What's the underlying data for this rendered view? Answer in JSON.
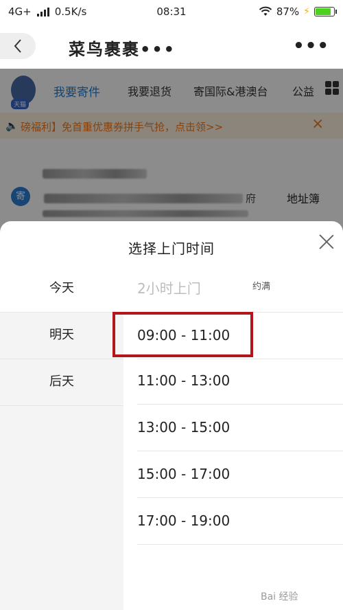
{
  "status_bar": {
    "network": "4G+",
    "speed": "0.5K/s",
    "time": "08:31",
    "battery_percent": "87%",
    "battery_level": 0.87
  },
  "header": {
    "title": "菜鸟裹裹•••"
  },
  "background_page": {
    "nav_items": [
      "我要寄件",
      "我要退货",
      "寄国际&港澳台",
      "公益"
    ],
    "notice": "磅福利】免首重优惠券拼手气抢，点击领>>",
    "send_badge": "寄",
    "fu_text": "府",
    "address_book": "地址簿",
    "avatar_tag": "天猫"
  },
  "sheet": {
    "title": "选择上门时间",
    "days": [
      "今天",
      "明天",
      "后天"
    ],
    "today_slot": "2小时上门",
    "today_note": "约满",
    "slots": [
      "09:00 - 11:00",
      "11:00 - 13:00",
      "13:00 - 15:00",
      "15:00 - 17:00",
      "17:00 - 19:00"
    ]
  },
  "watermark": "Bai 经验",
  "colors": {
    "accent_blue": "#1f7bd8",
    "notice_orange": "#f07a1e",
    "highlight_red": "#b3151b",
    "battery_green": "#4cd11c"
  }
}
